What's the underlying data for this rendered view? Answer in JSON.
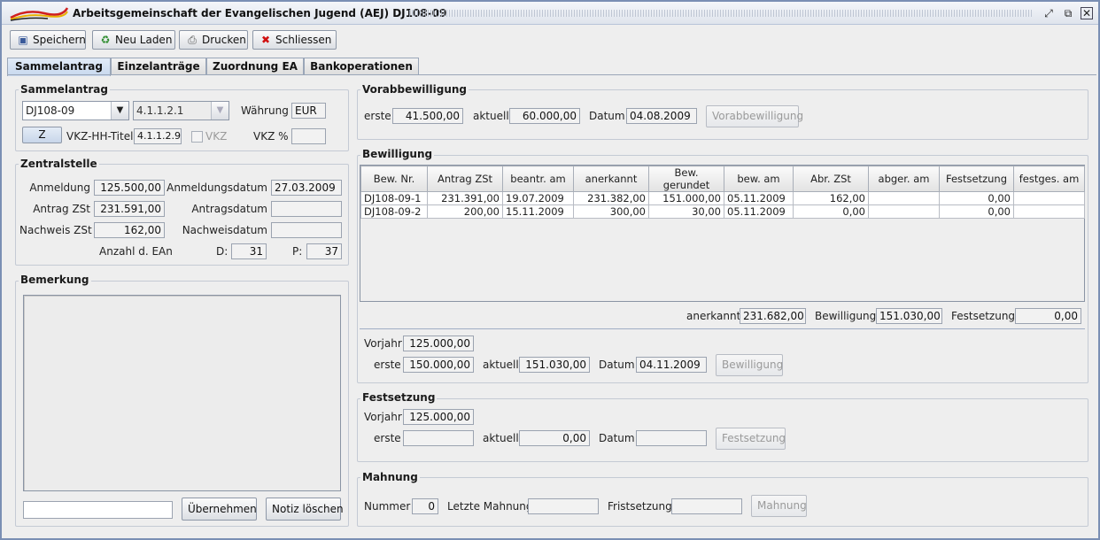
{
  "window": {
    "title": "Arbeitsgemeinschaft der Evangelischen Jugend (AEJ) DJ108-09",
    "icon": "aej-logo-icon"
  },
  "toolbar": {
    "save": "Speichern",
    "reload": "Neu Laden",
    "print": "Drucken",
    "close": "Schliessen"
  },
  "tabs": [
    "Sammelantrag",
    "Einzelanträge",
    "Zuordnung EA",
    "Bankoperationen"
  ],
  "sammelantrag": {
    "title": "Sammelantrag",
    "combo1": "DJ108-09",
    "combo2": "4.1.1.2.1",
    "waehrung_label": "Währung",
    "waehrung": "EUR",
    "z_button": "Z",
    "vkz_hh_label": "VKZ-HH-Titel",
    "vkz_hh": "4.1.1.2.9",
    "vkz_label": "VKZ",
    "vkz_pct_label": "VKZ %",
    "vkz_pct": ""
  },
  "zentralstelle": {
    "title": "Zentralstelle",
    "anmeldung_label": "Anmeldung",
    "anmeldung": "125.500,00",
    "anmeldedatum_label": "Anmeldungsdatum",
    "anmeldedatum": "27.03.2009",
    "antrag_label": "Antrag ZSt",
    "antrag": "231.591,00",
    "antragsdatum_label": "Antragsdatum",
    "antragsdatum": "",
    "nachweis_label": "Nachweis ZSt",
    "nachweis": "162,00",
    "nachweisdatum_label": "Nachweisdatum",
    "nachweisdatum": "",
    "anzahl_label": "Anzahl d. EAn",
    "d_label": "D:",
    "d_value": "31",
    "p_label": "P:",
    "p_value": "37"
  },
  "bemerkung": {
    "title": "Bemerkung",
    "text": "",
    "input": "",
    "uebernehmen": "Übernehmen",
    "notiz_loeschen": "Notiz löschen"
  },
  "vorabbewilligung": {
    "title": "Vorabbewilligung",
    "erste_label": "erste",
    "erste": "41.500,00",
    "aktuell_label": "aktuell",
    "aktuell": "60.000,00",
    "datum_label": "Datum",
    "datum": "04.08.2009",
    "button": "Vorabbewilligung"
  },
  "bewilligung": {
    "title": "Bewilligung",
    "columns": [
      "Bew. Nr.",
      "Antrag ZSt",
      "beantr. am",
      "anerkannt",
      "Bew. gerundet",
      "bew. am",
      "Abr. ZSt",
      "abger. am",
      "Festsetzung",
      "festges. am"
    ],
    "rows": [
      [
        "DJ108-09-1",
        "231.391,00",
        "19.07.2009",
        "231.382,00",
        "151.000,00",
        "05.11.2009",
        "162,00",
        "",
        "0,00",
        ""
      ],
      [
        "DJ108-09-2",
        "200,00",
        "15.11.2009",
        "300,00",
        "30,00",
        "05.11.2009",
        "0,00",
        "",
        "0,00",
        ""
      ]
    ],
    "anerkannt_label": "anerkannt",
    "anerkannt_sum": "231.682,00",
    "bewilligung_label": "Bewilligung",
    "bewilligung_sum": "151.030,00",
    "festsetzung_label": "Festsetzung",
    "festsetzung_sum": "0,00",
    "vorjahr_label": "Vorjahr",
    "vorjahr": "125.000,00",
    "erste_label": "erste",
    "erste": "150.000,00",
    "aktuell_label": "aktuell",
    "aktuell": "151.030,00",
    "datum_label": "Datum",
    "datum": "04.11.2009",
    "button": "Bewilligung"
  },
  "festsetzung": {
    "title": "Festsetzung",
    "vorjahr_label": "Vorjahr",
    "vorjahr": "125.000,00",
    "erste_label": "erste",
    "erste": "",
    "aktuell_label": "aktuell",
    "aktuell": "0,00",
    "datum_label": "Datum",
    "datum": "",
    "button": "Festsetzung"
  },
  "mahnung": {
    "title": "Mahnung",
    "nummer_label": "Nummer",
    "nummer": "0",
    "letzte_label": "Letzte Mahnung",
    "letzte": "",
    "frist_label": "Fristsetzung",
    "frist": "",
    "button": "Mahnung"
  }
}
